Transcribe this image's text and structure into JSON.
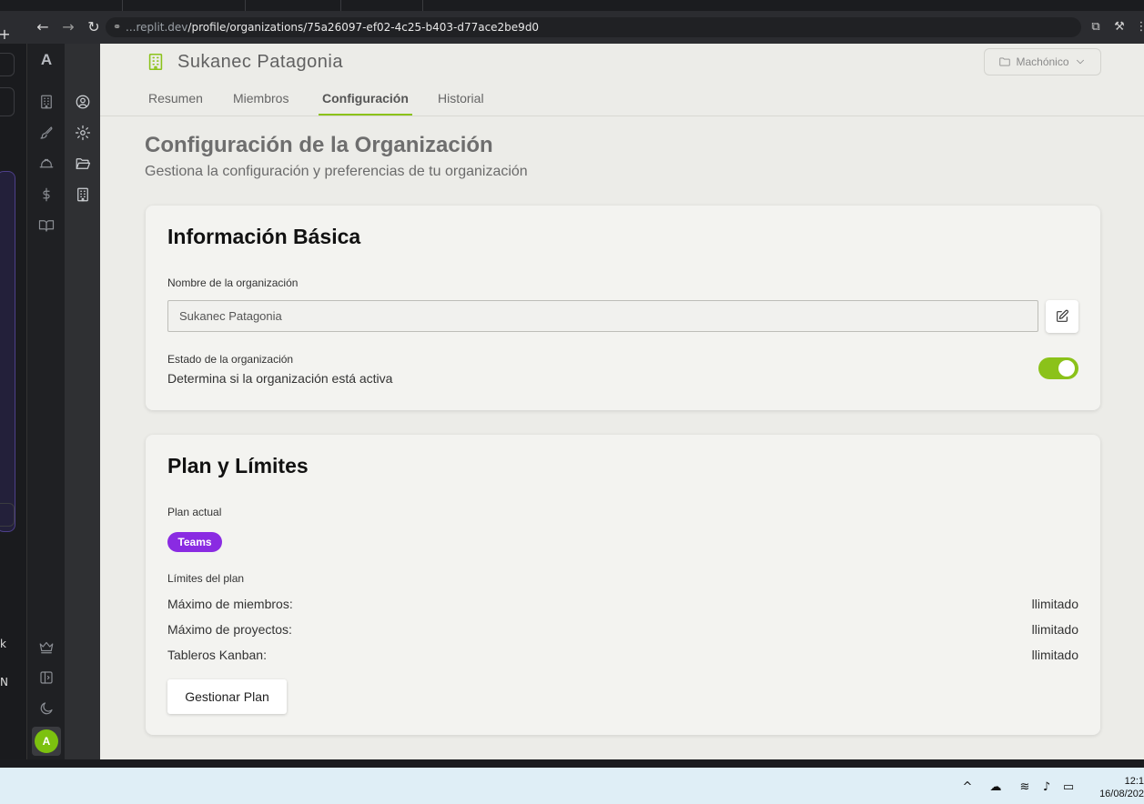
{
  "browser": {
    "url_prefix": "...replit.dev",
    "url_path": "/profile/organizations/75a26097-ef02-4c25-b403-d77ace2be9d0"
  },
  "side_panel": {
    "chars": [
      "+",
      "›",
      "k",
      "N",
      ">"
    ]
  },
  "rail": {
    "logo": "A",
    "avatar_initial": "A"
  },
  "header": {
    "org_name": "Sukanec Patagonia",
    "workspace_label": "Machónico",
    "tabs": [
      {
        "label": "Resumen"
      },
      {
        "label": "Miembros"
      },
      {
        "label": "Configuración",
        "active": true
      },
      {
        "label": "Historial"
      }
    ]
  },
  "page": {
    "title": "Configuración de la Organización",
    "subtitle": "Gestiona la configuración y preferencias de tu organización"
  },
  "basic_info": {
    "title": "Información Básica",
    "name_label": "Nombre de la organización",
    "name_value": "Sukanec Patagonia",
    "status_label": "Estado de la organización",
    "status_desc": "Determina si la organización está activa",
    "status_active": true
  },
  "plan": {
    "title": "Plan y Límites",
    "current_label": "Plan actual",
    "current_plan": "Teams",
    "limits_label": "Límites del plan",
    "limits": [
      {
        "label": "Máximo de miembros:",
        "value": "llimitado"
      },
      {
        "label": "Máximo de proyectos:",
        "value": "llimitado"
      },
      {
        "label": "Tableros Kanban:",
        "value": "llimitado"
      }
    ],
    "manage_button": "Gestionar Plan"
  },
  "taskbar": {
    "time": "12:1",
    "date": "16/08/202"
  },
  "colors": {
    "accent": "#8bc21a",
    "badge": "#8a2be2"
  }
}
